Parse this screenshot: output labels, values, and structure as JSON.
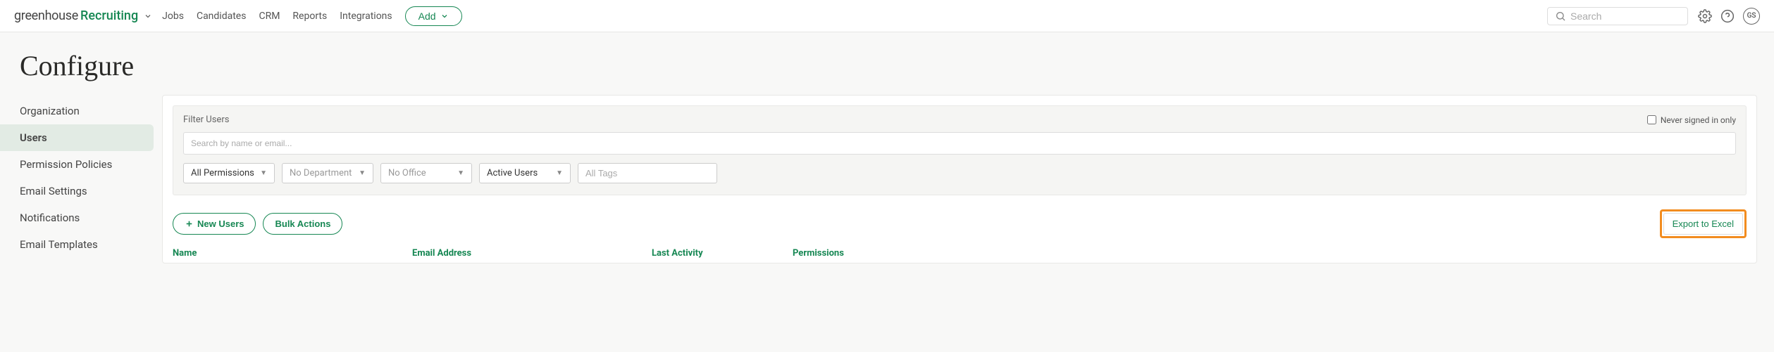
{
  "brand": {
    "part1": "greenhouse",
    "part2": "Recruiting"
  },
  "nav": {
    "links": [
      "Jobs",
      "Candidates",
      "CRM",
      "Reports",
      "Integrations"
    ],
    "add_label": "Add",
    "search_placeholder": "Search",
    "avatar_initials": "GS"
  },
  "page_title": "Configure",
  "sidebar": {
    "items": [
      {
        "label": "Organization",
        "active": false
      },
      {
        "label": "Users",
        "active": true
      },
      {
        "label": "Permission Policies",
        "active": false
      },
      {
        "label": "Email Settings",
        "active": false
      },
      {
        "label": "Notifications",
        "active": false
      },
      {
        "label": "Email Templates",
        "active": false
      }
    ]
  },
  "filters": {
    "title": "Filter Users",
    "never_signed_label": "Never signed in only",
    "search_placeholder": "Search by name or email...",
    "permissions": "All Permissions",
    "department": "No Department",
    "office": "No Office",
    "status": "Active Users",
    "tags_placeholder": "All Tags"
  },
  "actions": {
    "new_users": "New Users",
    "bulk_actions": "Bulk Actions",
    "export": "Export to Excel"
  },
  "table": {
    "columns": [
      "Name",
      "Email Address",
      "Last Activity",
      "Permissions"
    ]
  }
}
